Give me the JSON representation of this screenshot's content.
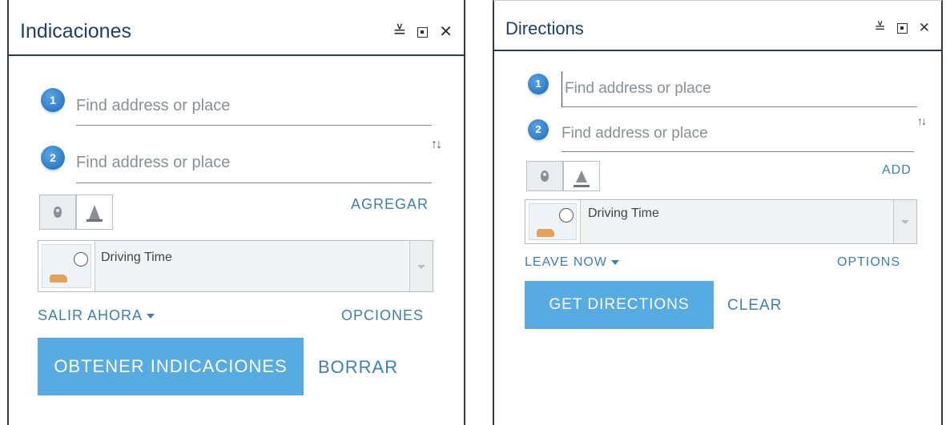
{
  "panels": [
    {
      "title": "Indicaciones",
      "stops": [
        {
          "number": "1",
          "placeholder": "Find address or place"
        },
        {
          "number": "2",
          "placeholder": "Find address or place"
        }
      ],
      "add_label": "AGREGAR",
      "travel_mode": "Driving Time",
      "leave_label": "SALIR AHORA",
      "options_label": "OPCIONES",
      "get_directions_label": "OBTENER INDICACIONES",
      "clear_label": "BORRAR"
    },
    {
      "title": "Directions",
      "stops": [
        {
          "number": "1",
          "placeholder": "Find address or place"
        },
        {
          "number": "2",
          "placeholder": "Find address or place"
        }
      ],
      "add_label": "ADD",
      "travel_mode": "Driving Time",
      "leave_label": "LEAVE NOW",
      "options_label": "OPTIONS",
      "get_directions_label": "GET DIRECTIONS",
      "clear_label": "CLEAR"
    }
  ],
  "icons": {
    "collapse": "chevron-double-down-icon",
    "restore": "restore-window-icon",
    "close": "close-icon",
    "swap": "swap-stops-icon",
    "stop_mode": "location-pin-icon",
    "barrier_mode": "traffic-cone-icon",
    "travel": "driving-time-icon"
  },
  "colors": {
    "title": "#1f3f6a",
    "accent": "#3c7fb8",
    "primary_button": "#56abe2",
    "stop_badge": "#1a6bbf"
  }
}
